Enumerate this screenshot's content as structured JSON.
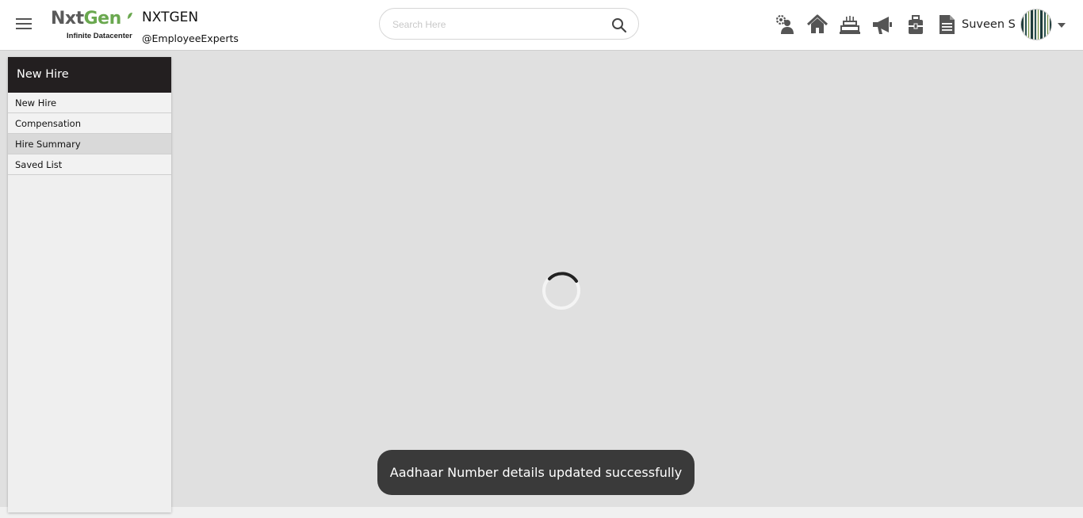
{
  "header": {
    "logo": {
      "word_dark": "Nxt",
      "word_green": "Gen",
      "tagline": "Infinite Datacenter"
    },
    "company_name": "NXTGEN",
    "company_handle": "@EmployeeExperts",
    "search": {
      "placeholder": "Search Here",
      "value": ""
    },
    "icons": [
      "people-gear-icon",
      "home-icon",
      "birthday-cake-icon",
      "megaphone-icon",
      "briefcase-icon",
      "document-icon"
    ],
    "user_name": "Suveen S"
  },
  "sidebar": {
    "title": "New Hire",
    "items": [
      {
        "label": "New Hire",
        "active": false
      },
      {
        "label": "Compensation",
        "active": false
      },
      {
        "label": "Hire Summary",
        "active": true
      },
      {
        "label": "Saved List",
        "active": false
      }
    ]
  },
  "toast": {
    "message": "Aadhaar Number details updated successfully"
  },
  "colors": {
    "header_bg": "#ffffff",
    "sidebar_title_bg": "#231f20",
    "content_bg": "#e0e0e0",
    "toast_bg": "#3a3a3a",
    "logo_green": "#6aa84f",
    "icon_gray": "#555555"
  }
}
